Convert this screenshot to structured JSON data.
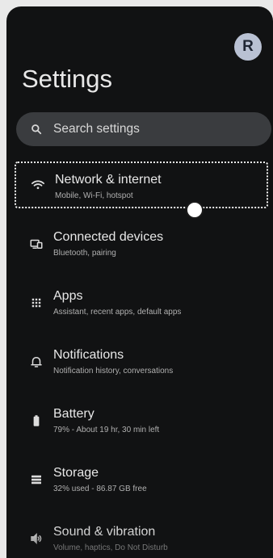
{
  "header": {
    "title": "Settings",
    "avatar_initial": "R"
  },
  "search": {
    "placeholder": "Search settings"
  },
  "items": [
    {
      "label": "Network & internet",
      "sub": "Mobile, Wi-Fi, hotspot",
      "icon": "wifi-icon"
    },
    {
      "label": "Connected devices",
      "sub": "Bluetooth, pairing",
      "icon": "connected-devices-icon"
    },
    {
      "label": "Apps",
      "sub": "Assistant, recent apps, default apps",
      "icon": "apps-grid-icon"
    },
    {
      "label": "Notifications",
      "sub": "Notification history, conversations",
      "icon": "bell-icon"
    },
    {
      "label": "Battery",
      "sub": "79% - About 19 hr, 30 min left",
      "icon": "battery-icon"
    },
    {
      "label": "Storage",
      "sub": "32% used - 86.87 GB free",
      "icon": "storage-icon"
    },
    {
      "label": "Sound & vibration",
      "sub": "Volume, haptics, Do Not Disturb",
      "icon": "speaker-icon"
    }
  ],
  "colors": {
    "background": "#111213",
    "search_bg": "#3a3c3f",
    "avatar_bg": "#b9c1d3",
    "text": "#e8e8e8",
    "subtext": "#b0b0b0"
  }
}
